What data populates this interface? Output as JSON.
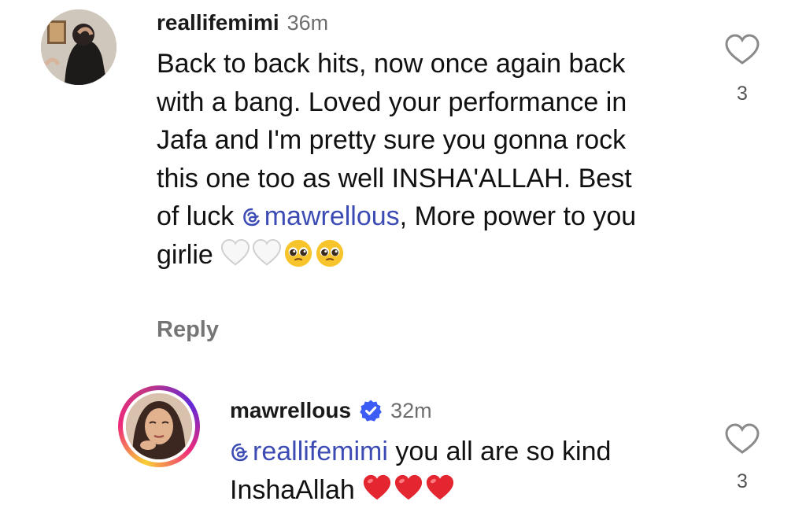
{
  "comments": [
    {
      "username": "reallifemimi",
      "time": "36m",
      "text_before": "Back to back hits, now once again back with a bang. Loved your performance in Jafa and I'm pretty sure you gonna rock this one too as well INSHA'ALLAH. Best of luck ",
      "mention": "mawrellous",
      "text_after": ", More power to you girlie",
      "emojis": [
        "white-heart",
        "white-heart",
        "pleading-face",
        "pleading-face"
      ],
      "reply_label": "Reply",
      "like_count": "3"
    },
    {
      "username": "mawrellous",
      "verified": true,
      "time": "32m",
      "mention": "reallifemimi",
      "text_after": " you all are so kind InshaAllah",
      "emojis": [
        "red-heart",
        "red-heart",
        "red-heart"
      ],
      "like_count": "3"
    }
  ],
  "colors": {
    "mention": "#3d4cb4",
    "verified": "#3b5cf5",
    "time": "#6e6e6e",
    "reply": "#757575"
  }
}
